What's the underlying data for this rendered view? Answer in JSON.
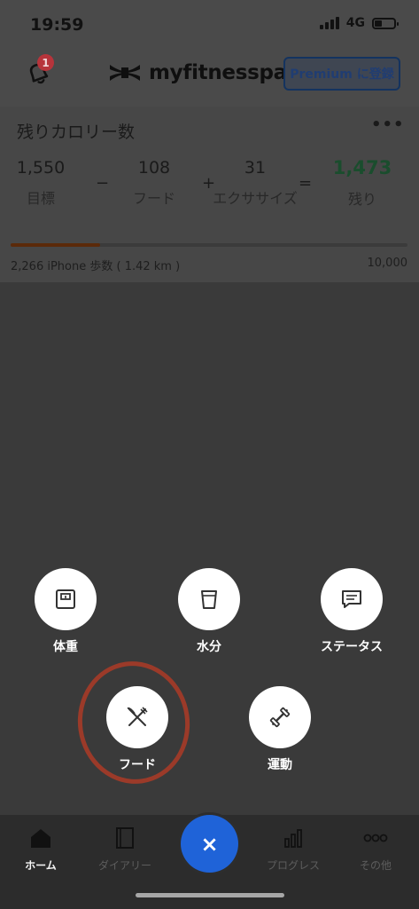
{
  "status_bar": {
    "time": "19:59",
    "network": "4G"
  },
  "header": {
    "notification_count": "1",
    "logo_text": "myfitnesspal",
    "premium_label": "Premium に登録"
  },
  "calories": {
    "title": "残りカロリー数",
    "goal": {
      "value": "1,550",
      "label": "目標"
    },
    "food": {
      "value": "108",
      "label": "フード"
    },
    "exercise": {
      "value": "31",
      "label": "エクササイズ"
    },
    "remaining": {
      "value": "1,473",
      "label": "残り"
    },
    "op_minus": "−",
    "op_plus": "+",
    "op_equals": "=",
    "steps_text": "2,266 iPhone 歩数 ( 1.42 km )",
    "steps_goal": "10,000",
    "steps_fraction": 0.226
  },
  "quick_actions": {
    "weight": "体重",
    "water": "水分",
    "status": "ステータス",
    "food": "フード",
    "exercise": "運動"
  },
  "tabs": [
    {
      "label": "ホーム",
      "icon": "home-icon"
    },
    {
      "label": "ダイアリー",
      "icon": "diary-icon"
    },
    {
      "label": "プログレス",
      "icon": "progress-chart-icon"
    },
    {
      "label": "その他",
      "icon": "more-icon"
    }
  ],
  "fab_symbol": "×",
  "colors": {
    "accent": "#1f63d8",
    "remaining": "#1a4d2d",
    "annotation": "#9b3a29"
  }
}
